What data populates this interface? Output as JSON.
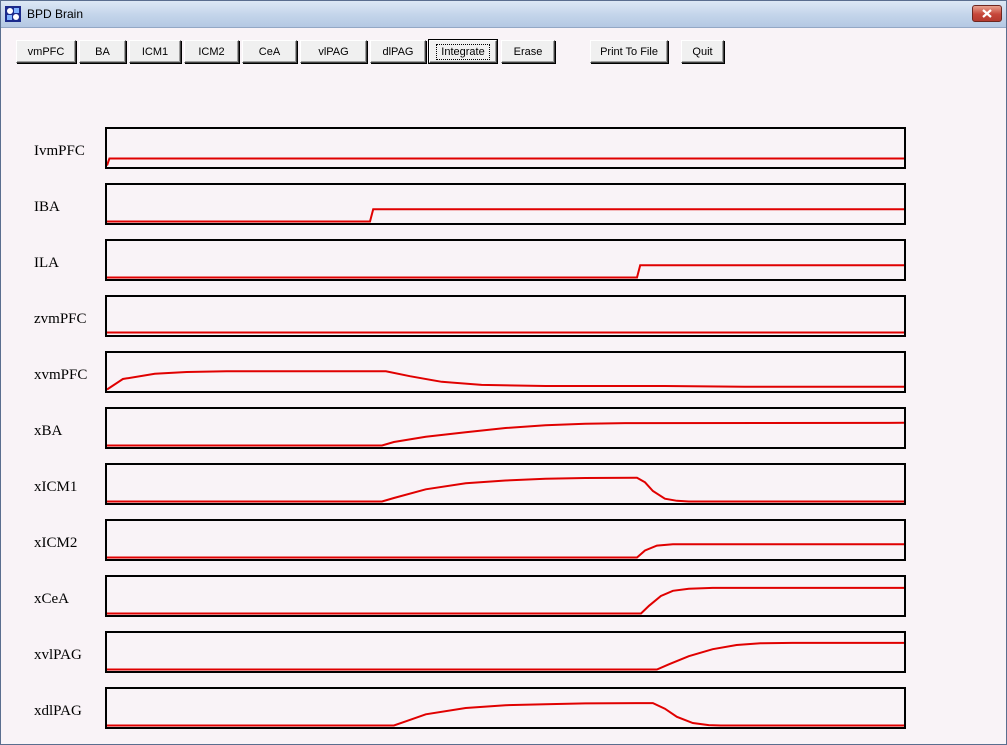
{
  "window": {
    "title": "BPD Brain"
  },
  "toolbar": {
    "buttons": [
      {
        "label": "vmPFC",
        "name": "vmpfc-button"
      },
      {
        "label": "BA",
        "name": "ba-button"
      },
      {
        "label": "ICM1",
        "name": "icm1-button"
      },
      {
        "label": "ICM2",
        "name": "icm2-button"
      },
      {
        "label": "CeA",
        "name": "cea-button"
      },
      {
        "label": "vlPAG",
        "name": "vlpag-button"
      },
      {
        "label": "dlPAG",
        "name": "dlpag-button"
      },
      {
        "label": "Integrate",
        "name": "integrate-button",
        "focused": true
      },
      {
        "label": "Erase",
        "name": "erase-button"
      },
      {
        "label": "Print To File",
        "name": "print-to-file-button"
      },
      {
        "label": "Quit",
        "name": "quit-button"
      }
    ]
  },
  "colors": {
    "trace": "#e00000",
    "frame": "#000000",
    "background": "#f9f3f7"
  },
  "chart_data": {
    "type": "line",
    "x_range": [
      0,
      1
    ],
    "y_range": [
      0,
      1
    ],
    "panels": [
      {
        "label": "IvmPFC",
        "points": [
          [
            0,
            0
          ],
          [
            0.003,
            0.2
          ],
          [
            1,
            0.2
          ]
        ]
      },
      {
        "label": "IBA",
        "points": [
          [
            0,
            0
          ],
          [
            0.33,
            0
          ],
          [
            0.334,
            0.35
          ],
          [
            1,
            0.35
          ]
        ]
      },
      {
        "label": "ILA",
        "points": [
          [
            0,
            0
          ],
          [
            0.665,
            0
          ],
          [
            0.669,
            0.35
          ],
          [
            1,
            0.35
          ]
        ]
      },
      {
        "label": "zvmPFC",
        "points": [
          [
            0,
            0.03
          ],
          [
            1,
            0.03
          ]
        ]
      },
      {
        "label": "xvmPFC",
        "points": [
          [
            0,
            0
          ],
          [
            0.02,
            0.3
          ],
          [
            0.06,
            0.45
          ],
          [
            0.1,
            0.5
          ],
          [
            0.15,
            0.52
          ],
          [
            0.35,
            0.52
          ],
          [
            0.38,
            0.38
          ],
          [
            0.42,
            0.22
          ],
          [
            0.47,
            0.13
          ],
          [
            0.55,
            0.1
          ],
          [
            0.7,
            0.1
          ],
          [
            0.8,
            0.08
          ],
          [
            1,
            0.08
          ]
        ]
      },
      {
        "label": "xBA",
        "points": [
          [
            0,
            0
          ],
          [
            0.345,
            0
          ],
          [
            0.36,
            0.1
          ],
          [
            0.4,
            0.25
          ],
          [
            0.45,
            0.38
          ],
          [
            0.5,
            0.5
          ],
          [
            0.55,
            0.58
          ],
          [
            0.6,
            0.62
          ],
          [
            0.65,
            0.64
          ],
          [
            1,
            0.65
          ]
        ]
      },
      {
        "label": "xICM1",
        "points": [
          [
            0,
            0
          ],
          [
            0.345,
            0
          ],
          [
            0.36,
            0.1
          ],
          [
            0.4,
            0.35
          ],
          [
            0.45,
            0.52
          ],
          [
            0.5,
            0.6
          ],
          [
            0.55,
            0.65
          ],
          [
            0.6,
            0.67
          ],
          [
            0.665,
            0.68
          ],
          [
            0.675,
            0.55
          ],
          [
            0.685,
            0.3
          ],
          [
            0.7,
            0.08
          ],
          [
            0.715,
            0.02
          ],
          [
            0.73,
            0
          ],
          [
            1,
            0
          ]
        ]
      },
      {
        "label": "xICM2",
        "points": [
          [
            0,
            0
          ],
          [
            0.665,
            0
          ],
          [
            0.675,
            0.2
          ],
          [
            0.69,
            0.34
          ],
          [
            0.71,
            0.38
          ],
          [
            1,
            0.38
          ]
        ]
      },
      {
        "label": "xCeA",
        "points": [
          [
            0,
            0
          ],
          [
            0.67,
            0
          ],
          [
            0.68,
            0.22
          ],
          [
            0.695,
            0.5
          ],
          [
            0.71,
            0.65
          ],
          [
            0.73,
            0.71
          ],
          [
            0.76,
            0.73
          ],
          [
            1,
            0.73
          ]
        ]
      },
      {
        "label": "xvlPAG",
        "points": [
          [
            0,
            0
          ],
          [
            0.69,
            0
          ],
          [
            0.705,
            0.15
          ],
          [
            0.73,
            0.38
          ],
          [
            0.76,
            0.58
          ],
          [
            0.79,
            0.7
          ],
          [
            0.82,
            0.75
          ],
          [
            0.86,
            0.76
          ],
          [
            1,
            0.76
          ]
        ]
      },
      {
        "label": "xdlPAG",
        "points": [
          [
            0,
            0
          ],
          [
            0.36,
            0
          ],
          [
            0.375,
            0.12
          ],
          [
            0.4,
            0.32
          ],
          [
            0.45,
            0.5
          ],
          [
            0.5,
            0.58
          ],
          [
            0.55,
            0.61
          ],
          [
            0.6,
            0.63
          ],
          [
            0.685,
            0.64
          ],
          [
            0.7,
            0.48
          ],
          [
            0.715,
            0.25
          ],
          [
            0.735,
            0.07
          ],
          [
            0.755,
            0.01
          ],
          [
            0.77,
            0
          ],
          [
            1,
            0
          ]
        ]
      }
    ]
  }
}
